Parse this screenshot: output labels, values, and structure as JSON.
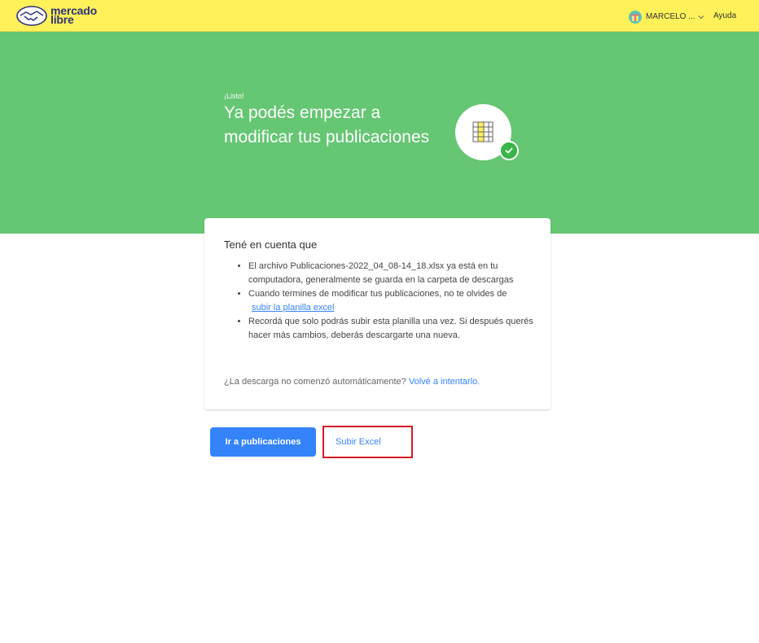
{
  "header": {
    "logo_line1": "mercado",
    "logo_line2": "libre",
    "user_name": "MARCELO ...",
    "help_label": "Ayuda"
  },
  "hero": {
    "kicker": "¡Listo!",
    "title": "Ya podés empezar a modificar tus publicaciones"
  },
  "card": {
    "title": "Tené en cuenta que",
    "items": [
      {
        "text": "El archivo Publicaciones-2022_04_08-14_18.xlsx ya está en tu computadora, generalmente se guarda en la carpeta de descargas"
      },
      {
        "text": "Cuando termines de modificar tus publicaciones, no te olvides de",
        "link": "subir la planilla excel"
      },
      {
        "text": "Recordá que solo podrás subir esta planilla una vez. Si después querés hacer más cambios, deberás descargarte una nueva."
      }
    ],
    "footer_text": "¿La descarga no comenzó automáticamente?",
    "footer_link": "Volvé a intentarlo."
  },
  "actions": {
    "primary_label": "Ir a publicaciones",
    "secondary_label": "Subir Excel"
  },
  "colors": {
    "header_bg": "#fff159",
    "hero_bg": "#65c673",
    "accent": "#3483fa",
    "highlight_border": "#d51a23",
    "check": "#39b54a"
  }
}
